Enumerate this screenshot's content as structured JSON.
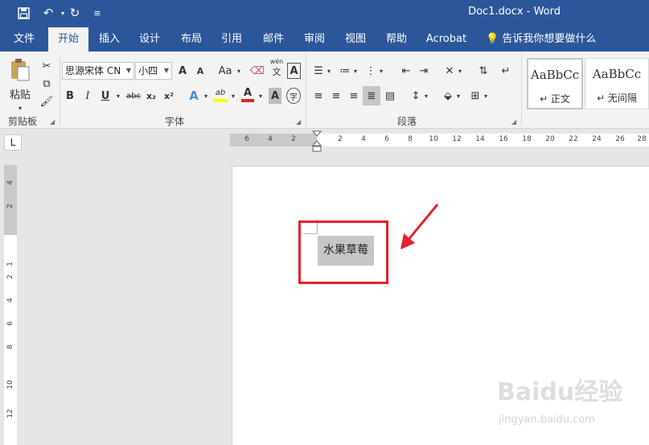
{
  "titlebar": {
    "doc_title": "Doc1.docx  -  Word"
  },
  "tabs": [
    {
      "label": "文件"
    },
    {
      "label": "开始"
    },
    {
      "label": "插入"
    },
    {
      "label": "设计"
    },
    {
      "label": "布局"
    },
    {
      "label": "引用"
    },
    {
      "label": "邮件"
    },
    {
      "label": "审阅"
    },
    {
      "label": "视图"
    },
    {
      "label": "帮助"
    },
    {
      "label": "Acrobat"
    }
  ],
  "tellme": "告诉我你想要做什么",
  "ribbon": {
    "clipboard": {
      "paste_label": "粘贴",
      "group_label": "剪贴板"
    },
    "font": {
      "font_name": "思源宋体 CN",
      "font_size": "小四",
      "group_label": "字体",
      "bold": "B",
      "italic": "I",
      "underline": "U",
      "strike": "abc",
      "sub": "x₂",
      "sup": "x²",
      "grow": "A",
      "shrink": "A",
      "case": "Aa",
      "phonetic": "wén",
      "phonetic_char": "文",
      "border_char": "A",
      "effects": "A",
      "highlight": "ab",
      "color": "A",
      "shade": "A",
      "enclose": "字"
    },
    "paragraph": {
      "group_label": "段落"
    },
    "styles": [
      {
        "sample": "AaBbCc",
        "name": "↵ 正文"
      },
      {
        "sample": "AaBbCc",
        "name": "↵ 无间隔"
      }
    ]
  },
  "ruler": {
    "tab_selector": "L",
    "ticks": [
      "6",
      "4",
      "2",
      "2",
      "4",
      "6",
      "8",
      "10",
      "12",
      "14",
      "16",
      "18",
      "20",
      "22",
      "24",
      "26",
      "28"
    ],
    "vticks": [
      "4",
      "2",
      "1",
      "2",
      "4",
      "6",
      "8",
      "10",
      "12"
    ]
  },
  "document": {
    "text": "水果草莓"
  },
  "watermark": {
    "brand": "Baidu经验",
    "url": "jingyan.baidu.com"
  },
  "colors": {
    "brand": "#2b579a",
    "annotation": "#e8202a",
    "selection": "#c6c6c6"
  }
}
